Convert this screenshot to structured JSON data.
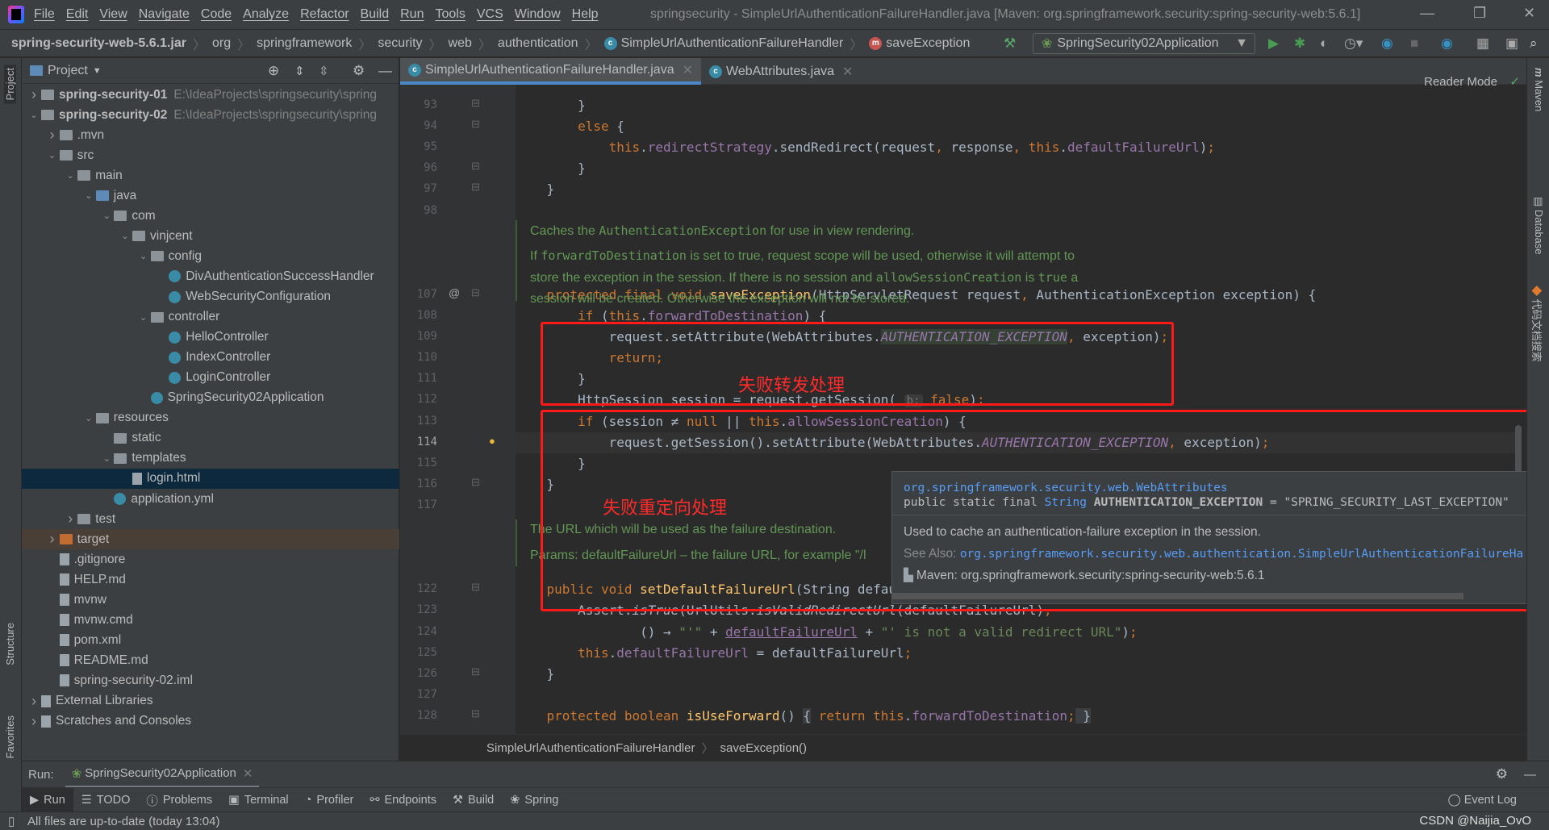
{
  "menu": [
    "File",
    "Edit",
    "View",
    "Navigate",
    "Code",
    "Analyze",
    "Refactor",
    "Build",
    "Run",
    "Tools",
    "VCS",
    "Window",
    "Help"
  ],
  "window_title": "springsecurity - SimpleUrlAuthenticationFailureHandler.java [Maven: org.springframework.security:spring-security-web:5.6.1]",
  "nav": {
    "crumbs": [
      "spring-security-web-5.6.1.jar",
      "org",
      "springframework",
      "security",
      "web",
      "authentication",
      "SimpleUrlAuthenticationFailureHandler",
      "saveException"
    ],
    "run_config": "SpringSecurity02Application"
  },
  "left_strip": {
    "project": "Project",
    "structure": "Structure",
    "favorites": "Favorites"
  },
  "right_strip": {
    "maven": "Maven",
    "database": "Database",
    "plugin": "代码文档搜索"
  },
  "project": {
    "title": "Project",
    "items": [
      {
        "label": "spring-security-01",
        "path": "E:\\IdeaProjects\\springsecurity\\spring",
        "level": 0,
        "arrow": "right",
        "icon": "module-folder",
        "bold": true
      },
      {
        "label": "spring-security-02",
        "path": "E:\\IdeaProjects\\springsecurity\\spring",
        "level": 0,
        "arrow": "down",
        "icon": "module-folder",
        "bold": true
      },
      {
        "label": ".mvn",
        "level": 1,
        "arrow": "right",
        "icon": "folder"
      },
      {
        "label": "src",
        "level": 1,
        "arrow": "down",
        "icon": "folder"
      },
      {
        "label": "main",
        "level": 2,
        "arrow": "down",
        "icon": "folder"
      },
      {
        "label": "java",
        "level": 3,
        "arrow": "down",
        "icon": "source-folder"
      },
      {
        "label": "com",
        "level": 4,
        "arrow": "down",
        "icon": "package"
      },
      {
        "label": "vinjcent",
        "level": 5,
        "arrow": "down",
        "icon": "package"
      },
      {
        "label": "config",
        "level": 6,
        "arrow": "down",
        "icon": "package"
      },
      {
        "label": "DivAuthenticationSuccessHandler",
        "level": 7,
        "icon": "class"
      },
      {
        "label": "WebSecurityConfiguration",
        "level": 7,
        "icon": "class"
      },
      {
        "label": "controller",
        "level": 6,
        "arrow": "down",
        "icon": "package"
      },
      {
        "label": "HelloController",
        "level": 7,
        "icon": "class"
      },
      {
        "label": "IndexController",
        "level": 7,
        "icon": "class"
      },
      {
        "label": "LoginController",
        "level": 7,
        "icon": "class"
      },
      {
        "label": "SpringSecurity02Application",
        "level": 6,
        "icon": "spring-class"
      },
      {
        "label": "resources",
        "level": 3,
        "arrow": "down",
        "icon": "folder"
      },
      {
        "label": "static",
        "level": 4,
        "icon": "folder"
      },
      {
        "label": "templates",
        "level": 4,
        "arrow": "down",
        "icon": "folder"
      },
      {
        "label": "login.html",
        "level": 5,
        "icon": "html-file",
        "selected": true
      },
      {
        "label": "application.yml",
        "level": 4,
        "icon": "yml-file"
      },
      {
        "label": "test",
        "level": 2,
        "arrow": "right",
        "icon": "folder"
      },
      {
        "label": "target",
        "level": 1,
        "arrow": "right",
        "icon": "excluded-folder",
        "excluded": true
      },
      {
        "label": ".gitignore",
        "level": 1,
        "icon": "file"
      },
      {
        "label": "HELP.md",
        "level": 1,
        "icon": "md-file"
      },
      {
        "label": "mvnw",
        "level": 1,
        "icon": "file"
      },
      {
        "label": "mvnw.cmd",
        "level": 1,
        "icon": "file"
      },
      {
        "label": "pom.xml",
        "level": 1,
        "icon": "maven-file"
      },
      {
        "label": "README.md",
        "level": 1,
        "icon": "md-file"
      },
      {
        "label": "spring-security-02.iml",
        "level": 1,
        "icon": "file"
      },
      {
        "label": "External Libraries",
        "level": 0,
        "arrow": "right",
        "icon": "libraries"
      },
      {
        "label": "Scratches and Consoles",
        "level": 0,
        "arrow": "right",
        "icon": "scratches"
      }
    ]
  },
  "editor": {
    "tabs": [
      {
        "label": "SimpleUrlAuthenticationFailureHandler.java",
        "active": true
      },
      {
        "label": "WebAttributes.java"
      }
    ],
    "reader_mode": "Reader Mode",
    "current_line": "114",
    "lines": [
      {
        "n": "93",
        "row": 0,
        "t": [
          [
            "",
            "        }"
          ]
        ]
      },
      {
        "n": "94",
        "row": 1,
        "t": [
          [
            "kw",
            "        else"
          ],
          [
            "",
            " {"
          ]
        ]
      },
      {
        "n": "95",
        "row": 2,
        "t": [
          [
            "kw",
            "            this"
          ],
          [
            "",
            "."
          ],
          [
            "fld",
            "redirectStrategy"
          ],
          [
            "",
            ".sendRedirect(request"
          ],
          [
            "kw",
            ","
          ],
          [
            "",
            " response"
          ],
          [
            "kw",
            ","
          ],
          [
            "kw",
            " this"
          ],
          [
            "",
            "."
          ],
          [
            "fld",
            "defaultFailureUrl"
          ],
          [
            "",
            ")"
          ],
          [
            "kw",
            ";"
          ]
        ]
      },
      {
        "n": "96",
        "row": 3,
        "t": [
          [
            "",
            "        }"
          ]
        ]
      },
      {
        "n": "97",
        "row": 4,
        "t": [
          [
            "",
            "    }"
          ]
        ]
      },
      {
        "n": "98",
        "row": 5,
        "t": []
      },
      {
        "n": "107",
        "row": 9,
        "t": [
          [
            "kw",
            "    protected final void "
          ],
          [
            "fn",
            "saveException"
          ],
          [
            "",
            "(HttpServletRequest request"
          ],
          [
            "kw",
            ","
          ],
          [
            "",
            " AuthenticationException exception) {"
          ]
        ]
      },
      {
        "n": "108",
        "row": 10,
        "t": [
          [
            "kw",
            "        if "
          ],
          [
            "",
            "("
          ],
          [
            "kw",
            "this"
          ],
          [
            "",
            "."
          ],
          [
            "fld",
            "forwardToDestination"
          ],
          [
            "",
            ") {"
          ]
        ]
      },
      {
        "n": "109",
        "row": 11,
        "t": [
          [
            "",
            "            request.setAttribute(WebAttributes."
          ],
          [
            "cst hl",
            "AUTHENTICATION_EXCEPTION"
          ],
          [
            "kw",
            ","
          ],
          [
            "",
            " exception)"
          ],
          [
            "kw",
            ";"
          ]
        ]
      },
      {
        "n": "110",
        "row": 12,
        "t": [
          [
            "kw",
            "            return;"
          ]
        ]
      },
      {
        "n": "111",
        "row": 13,
        "t": [
          [
            "",
            "        }"
          ]
        ]
      },
      {
        "n": "112",
        "row": 14,
        "t": [
          [
            "",
            "        HttpSession session = request.getSession( "
          ],
          [
            "hint",
            "b:"
          ],
          [
            "kw",
            " false"
          ],
          [
            "",
            ")"
          ],
          [
            "kw",
            ";"
          ]
        ]
      },
      {
        "n": "113",
        "row": 15,
        "t": [
          [
            "kw",
            "        if "
          ],
          [
            "",
            "(session ≠ "
          ],
          [
            "kw",
            "null"
          ],
          [
            "",
            " || "
          ],
          [
            "kw",
            "this"
          ],
          [
            "",
            "."
          ],
          [
            "fld",
            "allowSessionCreation"
          ],
          [
            "",
            ") {"
          ]
        ]
      },
      {
        "n": "114",
        "row": 16,
        "t": [
          [
            "",
            "            request.getSession().setAttribute(WebAttributes."
          ],
          [
            "cst",
            "AUTHENTICATION_EXCEPTION"
          ],
          [
            "kw",
            ","
          ],
          [
            "",
            " exception)"
          ],
          [
            "kw",
            ";"
          ]
        ]
      },
      {
        "n": "115",
        "row": 17,
        "t": [
          [
            "",
            "        }"
          ]
        ]
      },
      {
        "n": "116",
        "row": 18,
        "t": [
          [
            "",
            "    }"
          ]
        ]
      },
      {
        "n": "117",
        "row": 19,
        "t": []
      },
      {
        "n": "122",
        "row": 23,
        "t": [
          [
            "kw",
            "    public void "
          ],
          [
            "fn",
            "setDefaultFailureUrl"
          ],
          [
            "",
            "(String defaultFailureUrl) {"
          ]
        ]
      },
      {
        "n": "123",
        "row": 24,
        "t": [
          [
            "",
            "        Assert."
          ],
          [
            "it",
            "isTrue"
          ],
          [
            "",
            "(UrlUtils."
          ],
          [
            "it",
            "isValidRedirectUrl"
          ],
          [
            "",
            "(defaultFailureUrl)"
          ],
          [
            "kw",
            ","
          ]
        ]
      },
      {
        "n": "124",
        "row": 25,
        "t": [
          [
            "",
            "                () → "
          ],
          [
            "str",
            "\"'\""
          ],
          [
            "",
            " + "
          ],
          [
            "und",
            "defaultFailureUrl"
          ],
          [
            "",
            " + "
          ],
          [
            "str",
            "\"' is not a valid redirect URL\""
          ],
          [
            "",
            ")"
          ],
          [
            "kw",
            ";"
          ]
        ]
      },
      {
        "n": "125",
        "row": 26,
        "t": [
          [
            "kw",
            "        this"
          ],
          [
            "",
            "."
          ],
          [
            "fld",
            "defaultFailureUrl"
          ],
          [
            "",
            " = defaultFailureUrl"
          ],
          [
            "kw",
            ";"
          ]
        ]
      },
      {
        "n": "126",
        "row": 27,
        "t": [
          [
            "",
            "    }"
          ]
        ]
      },
      {
        "n": "127",
        "row": 28,
        "t": []
      },
      {
        "n": "128",
        "row": 29,
        "t": [
          [
            "kw",
            "    protected boolean "
          ],
          [
            "fn",
            "isUseForward"
          ],
          [
            "",
            "() "
          ],
          [
            "fold",
            "{"
          ],
          [
            "kw",
            " return this"
          ],
          [
            "",
            "."
          ],
          [
            "fld",
            "forwardToDestination"
          ],
          [
            "kw",
            ";"
          ],
          [
            "fold",
            " }"
          ]
        ]
      }
    ],
    "doc1": {
      "l1a": "Caches the ",
      "l1b": "AuthenticationException",
      "l1c": " for use in view rendering.",
      "l2a": "If ",
      "l2b": "forwardToDestination",
      "l2c": " is set to true, request scope will be used, otherwise it will attempt to",
      "l3a": "store the exception in the session. If there is no session and ",
      "l3b": "allowSessionCreation",
      "l3c": " is ",
      "l3d": "true",
      "l3e": " a",
      "l4": "session will be created. Otherwise the exception will not be stored."
    },
    "doc2": {
      "l1": "The URL which will be used as the failure destination.",
      "l2": "Params: defaultFailureUrl – the failure URL, for example \"/l"
    },
    "annotations": {
      "forward": "失败转发处理",
      "redirect": "失败重定向处理",
      "color": "#ff1a1a"
    },
    "breadcrumb": [
      "SimpleUrlAuthenticationFailureHandler",
      "saveException()"
    ]
  },
  "popup": {
    "class": "org.springframework.security.web.WebAttributes",
    "sig_a": "public static final ",
    "sig_b": "String",
    "sig_c": " AUTHENTICATION_EXCEPTION",
    "sig_d": " = \"SPRING_SECURITY_LAST_EXCEPTION\"",
    "desc": "Used to cache an authentication-failure exception in the session.",
    "see_label": "See Also:",
    "see_link": "org.springframework.security.web.authentication.SimpleUrlAuthenticationFailureHa",
    "source": "Maven: org.springframework.security:spring-security-web:5.6.1"
  },
  "run": {
    "label": "Run:",
    "config": "SpringSecurity02Application"
  },
  "tool_tabs": [
    "Run",
    "TODO",
    "Problems",
    "Terminal",
    "Profiler",
    "Endpoints",
    "Build",
    "Spring"
  ],
  "event_log": "Event Log",
  "status": "All files are up-to-date (today 13:04)",
  "watermark": "CSDN @Naijia_OvO"
}
